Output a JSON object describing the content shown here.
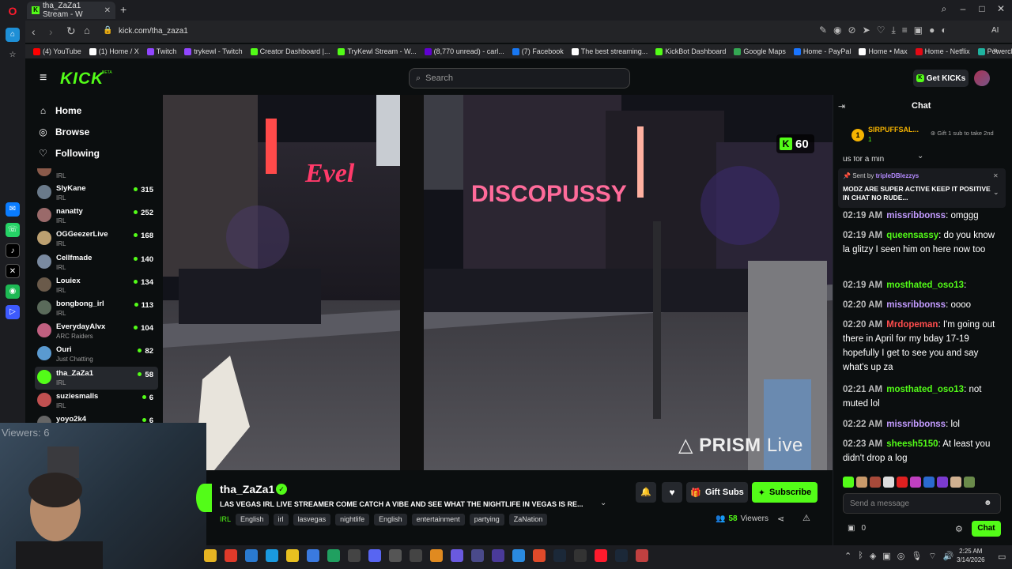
{
  "browser": {
    "tab_title": "tha_ZaZa1 Stream - W",
    "url": "kick.com/tha_zaza1",
    "new_tab": "+",
    "ai_label": "AI",
    "bookmarks": [
      {
        "label": "(4) YouTube",
        "color": "#ff0000"
      },
      {
        "label": "(1) Home / X",
        "color": "#ffffff"
      },
      {
        "label": "Twitch",
        "color": "#9146ff"
      },
      {
        "label": "trykewl - Twitch",
        "color": "#9146ff"
      },
      {
        "label": "Creator Dashboard |...",
        "color": "#53fc18"
      },
      {
        "label": "TryKewl Stream - W...",
        "color": "#53fc18"
      },
      {
        "label": "(8,770 unread) - carl...",
        "color": "#6001d2"
      },
      {
        "label": "(7) Facebook",
        "color": "#1877f2"
      },
      {
        "label": "The best streaming...",
        "color": "#ffffff"
      },
      {
        "label": "KickBot Dashboard",
        "color": "#53fc18"
      },
      {
        "label": "Google Maps",
        "color": "#34a853"
      },
      {
        "label": "Home - PayPal",
        "color": "#1a75ff"
      },
      {
        "label": "Home • Max",
        "color": "#ffffff"
      },
      {
        "label": "Home - Netflix",
        "color": "#e50914"
      },
      {
        "label": "Powerchat",
        "color": "#1fb3a0"
      }
    ]
  },
  "header": {
    "logo": "KICK",
    "logo_badge": "BETA",
    "search_placeholder": "Search",
    "get_kicks": "Get KICKs"
  },
  "nav": {
    "home": "Home",
    "browse": "Browse",
    "following": "Following",
    "partial_top_category": "IRL",
    "channels": [
      {
        "name": "SlyKane",
        "category": "IRL",
        "viewers": "315",
        "color": "#6a7a8a"
      },
      {
        "name": "nanatty",
        "category": "IRL",
        "viewers": "252",
        "color": "#9a6a6a"
      },
      {
        "name": "OGGeezerLive",
        "category": "IRL",
        "viewers": "168",
        "color": "#bca070"
      },
      {
        "name": "Cellfmade",
        "category": "IRL",
        "viewers": "140",
        "color": "#7a8aa0"
      },
      {
        "name": "Louiex",
        "category": "IRL",
        "viewers": "134",
        "color": "#6a5a4a"
      },
      {
        "name": "bongbong_irl",
        "category": "IRL",
        "viewers": "113",
        "color": "#5a6a5a"
      },
      {
        "name": "EverydayAlvx",
        "category": "ARC Raiders",
        "viewers": "104",
        "color": "#c06080"
      },
      {
        "name": "Ouri",
        "category": "Just Chatting",
        "viewers": "82",
        "color": "#5a9ad0"
      },
      {
        "name": "tha_ZaZa1",
        "category": "IRL",
        "viewers": "58",
        "color": "#53fc18"
      },
      {
        "name": "suziesmalls",
        "category": "IRL",
        "viewers": "6",
        "color": "#c05050"
      },
      {
        "name": "yoyo2k4",
        "category": "",
        "viewers": "6",
        "color": "#666666"
      }
    ]
  },
  "video": {
    "kick_badge_count": "60",
    "watermark_bold": "PRISM",
    "watermark_light": "Live"
  },
  "webcam": {
    "viewers_overlay": "Viewers: 6"
  },
  "stream": {
    "name": "tha_ZaZa1",
    "title": "LAS VEGAS IRL LIVE STREAMER COME CATCH A VIBE AND SEE WHAT THE NIGHTLIFE IN VEGAS IS RE...",
    "category": "IRL",
    "tags": [
      "English",
      "irl",
      "lasvegas",
      "nightlife",
      "English",
      "entertainment",
      "partying",
      "ZaNation"
    ],
    "gift_subs": "Gift Subs",
    "subscribe": "Subscribe",
    "viewers": "58",
    "viewers_label": "Viewers"
  },
  "chat": {
    "title": "Chat",
    "top_gifter": {
      "rank": "1",
      "name": "SIRPUFFSAL...",
      "count": "1",
      "info": "Gift 1 sub to take 2nd"
    },
    "partial_text": "us for a min",
    "pinned": {
      "sent_by": "Sent by",
      "user": "tripleDBlezzys",
      "text": "MODZ ARE SUPER ACTIVE KEEP IT POSITIVE IN CHAT NO RUDE..."
    },
    "messages": [
      {
        "time": "02:19 AM",
        "user": "missribbonss",
        "color": "#c39bff",
        "text": ": omggg"
      },
      {
        "time": "02:19 AM",
        "user": "queensassy",
        "color": "#53fc18",
        "text": ": do you know la glitzy I seen him on here now too"
      },
      {
        "time": "02:19 AM",
        "user": "mosthated_oso13",
        "color": "#53fc18",
        "text": ":"
      },
      {
        "time": "02:20 AM",
        "user": "missribbonss",
        "color": "#c39bff",
        "text": ": oooo"
      },
      {
        "time": "02:20 AM",
        "user": "Mrdopeman",
        "color": "#ff4d4d",
        "text": ": I'm going out there in April for my bday 17-19 hopefully I get to see you and say what's up za"
      },
      {
        "time": "02:21 AM",
        "user": "mosthated_oso13",
        "color": "#53fc18",
        "text": ": not muted lol"
      },
      {
        "time": "02:22 AM",
        "user": "missribbonss",
        "color": "#c39bff",
        "text": ": lol"
      },
      {
        "time": "02:23 AM",
        "user": "sheesh5150",
        "color": "#53fc18",
        "text": ": At least you didn't drop a log"
      }
    ],
    "input_placeholder": "Send a message",
    "points": "0",
    "send": "Chat"
  },
  "taskbar": {
    "time": "2:25 AM",
    "date": "3/14/2026"
  }
}
